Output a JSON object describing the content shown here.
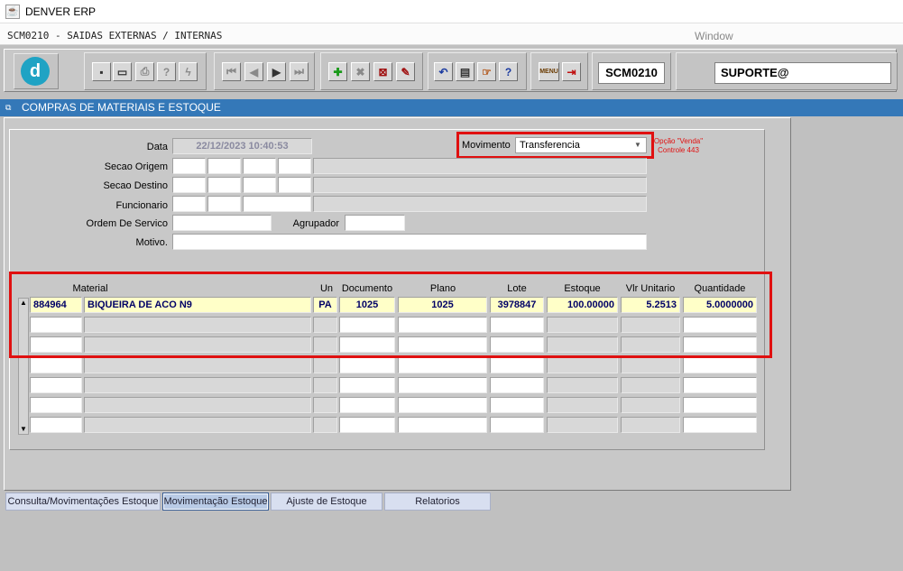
{
  "app": {
    "title": "DENVER ERP"
  },
  "menubar": {
    "module_title": "SCM0210 - SAIDAS EXTERNAS / INTERNAS",
    "window_menu": "Window"
  },
  "toolbar": {
    "form_code": "SCM0210",
    "user": "SUPORTE@",
    "logo_letter": "d"
  },
  "window": {
    "title": "COMPRAS DE MATERIAIS E ESTOQUE"
  },
  "form": {
    "data_label": "Data",
    "data_value": "22/12/2023 10:40:53",
    "movimento_label": "Movimento",
    "movimento_value": "Transferencia",
    "note": "Opção \"Venda\" Controle 443",
    "secao_origem_label": "Secao Origem",
    "secao_destino_label": "Secao Destino",
    "funcionario_label": "Funcionario",
    "ordem_label": "Ordem De Servico",
    "agrupador_label": "Agrupador",
    "motivo_label": "Motivo."
  },
  "grid": {
    "headers": {
      "material": "Material",
      "un": "Un",
      "documento": "Documento",
      "plano": "Plano",
      "lote": "Lote",
      "estoque": "Estoque",
      "vlr_unitario": "Vlr Unitario",
      "quantidade": "Quantidade"
    },
    "rows": [
      {
        "codigo": "884964",
        "descricao": "BIQUEIRA DE ACO N9",
        "un": "PA",
        "documento": "1025",
        "plano": "1025",
        "lote": "3978847",
        "estoque": "100.00000",
        "vlr_unitario": "5.2513",
        "quantidade": "5.0000000"
      }
    ]
  },
  "tabs": [
    {
      "label": "Consulta/Movimentações Estoque"
    },
    {
      "label": "Movimentação Estoque"
    },
    {
      "label": "Ajuste de Estoque"
    },
    {
      "label": "Relatorios"
    }
  ]
}
